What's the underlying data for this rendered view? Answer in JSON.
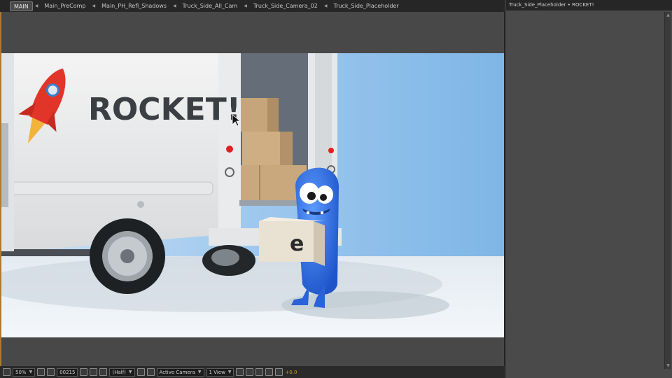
{
  "breadcrumbs": [
    {
      "label": "MAIN",
      "active": true
    },
    {
      "label": "Main_PreComp",
      "active": false
    },
    {
      "label": "Main_PH_Refl_Shadows",
      "active": false
    },
    {
      "label": "Truck_Side_All_Cam",
      "active": false
    },
    {
      "label": "Truck_Side_Camera_02",
      "active": false
    },
    {
      "label": "Truck_Side_Placeholder",
      "active": false
    }
  ],
  "viewer": {
    "truck_text": "ROCKET!",
    "box_letter": "e"
  },
  "toolbar": {
    "magnification": "50%",
    "timecode": "00215",
    "resolution": "(Half)",
    "camera": "Active Camera",
    "views": "1 View",
    "exposure": "+0.0"
  },
  "right_panel": {
    "title": "Truck_Side_Placeholder • ROCKET!"
  },
  "colors": {
    "panel_bg": "#484848",
    "titlebar_bg": "#262626",
    "accent_orange": "#c89a2a",
    "rocket_red": "#e2352a",
    "character_blue": "#2f6fe0"
  }
}
